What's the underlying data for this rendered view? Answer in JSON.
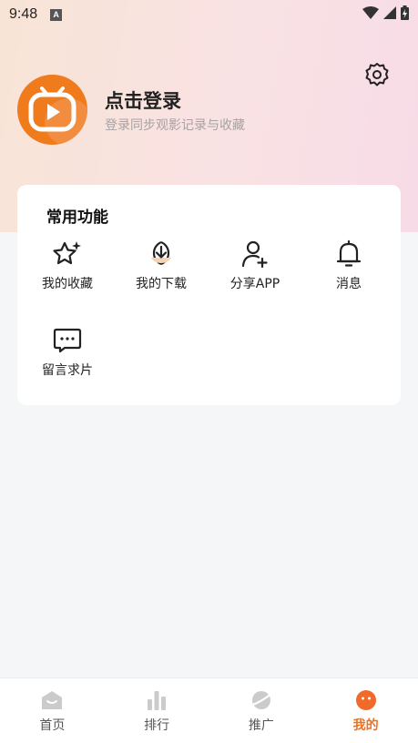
{
  "status": {
    "time": "9:48",
    "badge": "A"
  },
  "header": {
    "title": "点击登录",
    "subtitle": "登录同步观影记录与收藏"
  },
  "functions": {
    "title": "常用功能",
    "items": [
      {
        "label": "我的收藏",
        "icon": "star-icon"
      },
      {
        "label": "我的下载",
        "icon": "download-icon"
      },
      {
        "label": "分享APP",
        "icon": "user-add-icon"
      },
      {
        "label": "消息",
        "icon": "bell-icon"
      },
      {
        "label": "留言求片",
        "icon": "message-icon"
      }
    ]
  },
  "tabs": [
    {
      "label": "首页",
      "icon": "home-icon",
      "active": false
    },
    {
      "label": "排行",
      "icon": "chart-icon",
      "active": false
    },
    {
      "label": "推广",
      "icon": "planet-icon",
      "active": false
    },
    {
      "label": "我的",
      "icon": "profile-icon",
      "active": true
    }
  ],
  "colors": {
    "accent": "#f0701e",
    "inactive_icon": "#c8c8c8"
  }
}
